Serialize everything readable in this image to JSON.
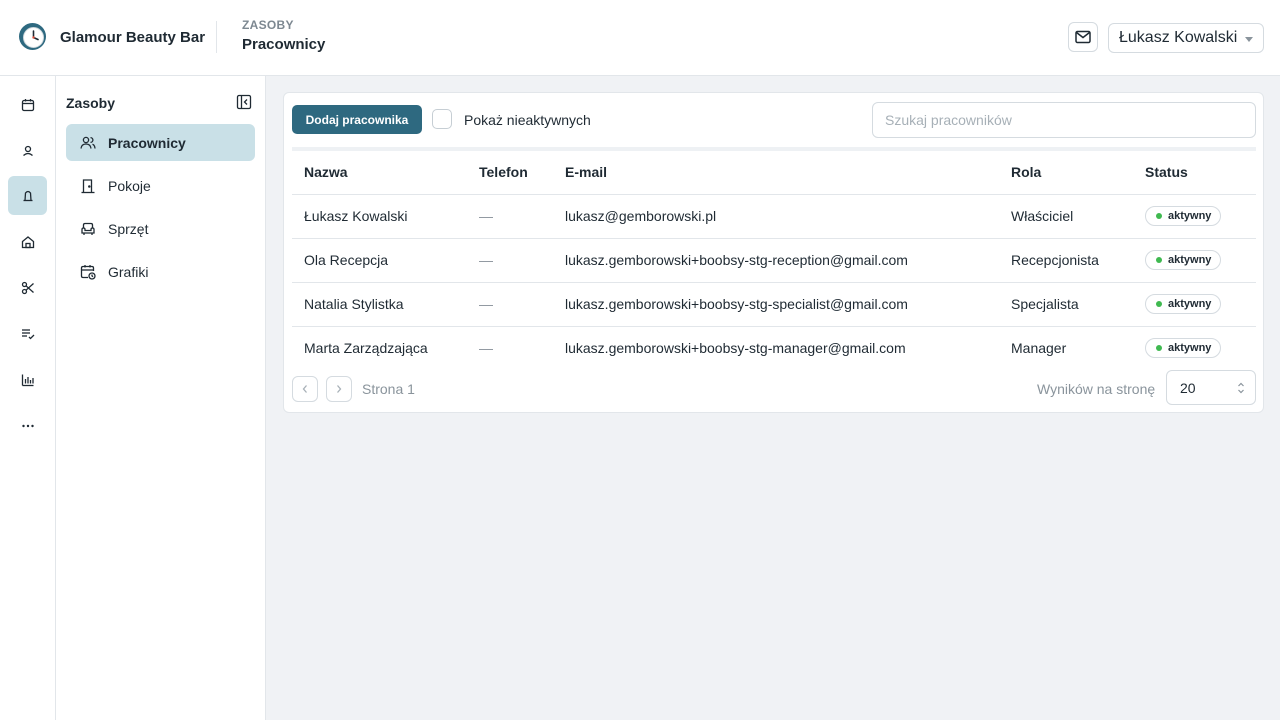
{
  "header": {
    "brand": "Glamour Beauty Bar",
    "section": "ZASOBY",
    "page": "Pracownicy",
    "user": "Łukasz Kowalski"
  },
  "rail": {
    "items": [
      {
        "icon": "calendar-icon",
        "active": false
      },
      {
        "icon": "client-icon",
        "active": false
      },
      {
        "icon": "resources-icon",
        "active": true
      },
      {
        "icon": "home-icon",
        "active": false
      },
      {
        "icon": "scissors-icon",
        "active": false
      },
      {
        "icon": "checklist-icon",
        "active": false
      },
      {
        "icon": "bar-chart-icon",
        "active": false
      },
      {
        "icon": "more-icon",
        "active": false
      }
    ]
  },
  "subnav": {
    "title": "Zasoby",
    "items": [
      {
        "label": "Pracownicy",
        "icon": "users-icon",
        "active": true
      },
      {
        "label": "Pokoje",
        "icon": "door-icon",
        "active": false
      },
      {
        "label": "Sprzęt",
        "icon": "armchair-icon",
        "active": false
      },
      {
        "label": "Grafiki",
        "icon": "calendar-clock-icon",
        "active": false
      }
    ]
  },
  "toolbar": {
    "add_label": "Dodaj pracownika",
    "show_inactive_label": "Pokaż nieaktywnych",
    "show_inactive_checked": false,
    "search_placeholder": "Szukaj pracowników",
    "search_value": ""
  },
  "table": {
    "columns": [
      "Nazwa",
      "Telefon",
      "E-mail",
      "Rola",
      "Status"
    ],
    "rows": [
      {
        "name": "Łukasz Kowalski",
        "phone": "—",
        "email": "lukasz@gemborowski.pl",
        "role": "Właściciel",
        "status": "aktywny"
      },
      {
        "name": "Ola Recepcja",
        "phone": "—",
        "email": "lukasz.gemborowski+boobsy-stg-reception@gmail.com",
        "role": "Recepcjonista",
        "status": "aktywny"
      },
      {
        "name": "Natalia Stylistka",
        "phone": "—",
        "email": "lukasz.gemborowski+boobsy-stg-specialist@gmail.com",
        "role": "Specjalista",
        "status": "aktywny"
      },
      {
        "name": "Marta Zarządzająca",
        "phone": "—",
        "email": "lukasz.gemborowski+boobsy-stg-manager@gmail.com",
        "role": "Manager",
        "status": "aktywny"
      }
    ]
  },
  "pagination": {
    "page_label": "Strona 1",
    "per_page_label": "Wyników na stronę",
    "per_page_value": "20"
  },
  "colors": {
    "accent": "#2e6980",
    "active_bg": "#c9e0e7",
    "status_active": "#3fb950"
  }
}
